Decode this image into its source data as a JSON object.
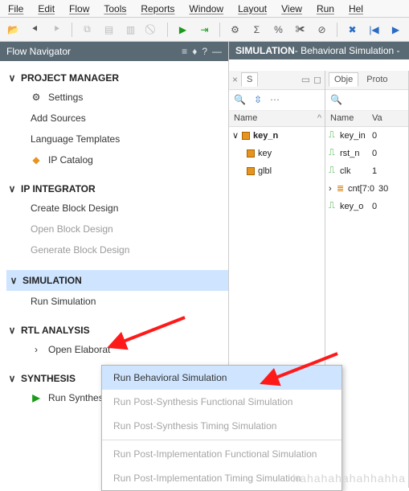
{
  "menu": {
    "items": [
      "File",
      "Edit",
      "Flow",
      "Tools",
      "Reports",
      "Window",
      "Layout",
      "View",
      "Run",
      "Hel"
    ]
  },
  "toolbar": {
    "icons": [
      "folder-open",
      "back",
      "history",
      "copy",
      "paste",
      "cut",
      "undo",
      "play",
      "step",
      "gear",
      "sigma",
      "percent",
      "scissors",
      "no-link",
      "resume",
      "next"
    ]
  },
  "nav": {
    "title": "Flow Navigator",
    "sections": [
      {
        "title": "PROJECT MANAGER",
        "items": [
          {
            "icon": "gear",
            "label": "Settings"
          },
          {
            "icon": "",
            "label": "Add Sources"
          },
          {
            "icon": "",
            "label": "Language Templates"
          },
          {
            "icon": "ip",
            "label": "IP Catalog"
          }
        ]
      },
      {
        "title": "IP INTEGRATOR",
        "items": [
          {
            "icon": "",
            "label": "Create Block Design"
          },
          {
            "icon": "",
            "label": "Open Block Design",
            "dim": true
          },
          {
            "icon": "",
            "label": "Generate Block Design",
            "dim": true
          }
        ]
      },
      {
        "title": "SIMULATION",
        "highlight": true,
        "items": [
          {
            "icon": "",
            "label": "Run Simulation"
          }
        ]
      },
      {
        "title": "RTL ANALYSIS",
        "items": [
          {
            "icon": "chev",
            "label": "Open Elaborat"
          }
        ]
      },
      {
        "title": "SYNTHESIS",
        "items": [
          {
            "icon": "play",
            "label": "Run Synthesis"
          }
        ]
      }
    ]
  },
  "right": {
    "header_bold": "SIMULATION",
    "header_rest": " - Behavioral Simulation -",
    "left_panel": {
      "tabs": [
        "S"
      ],
      "tools": [
        "search",
        "collapse",
        "more"
      ],
      "col": "Name",
      "rows": [
        {
          "lvl": 0,
          "icon": "orange",
          "label": "key_n",
          "exp": "∨"
        },
        {
          "lvl": 1,
          "icon": "orange",
          "label": "key"
        },
        {
          "lvl": 1,
          "icon": "orange",
          "label": "glbl"
        }
      ]
    },
    "right_panel": {
      "tabs": [
        "Obje",
        "Proto"
      ],
      "tools": [
        "search"
      ],
      "cols": [
        "Name",
        "Va"
      ],
      "rows": [
        {
          "icon": "sig",
          "label": "key_in",
          "val": "0"
        },
        {
          "icon": "sig",
          "label": "rst_n",
          "val": "0"
        },
        {
          "icon": "sig",
          "label": "clk",
          "val": "1"
        },
        {
          "icon": "bus",
          "label": "cnt[7:0",
          "val": "30",
          "exp": ">"
        },
        {
          "icon": "sig",
          "label": "key_o",
          "val": "0"
        }
      ]
    }
  },
  "popup": {
    "items": [
      {
        "label": "Run Behavioral Simulation",
        "hover": true
      },
      {
        "label": "Run Post-Synthesis Functional Simulation",
        "dim": true
      },
      {
        "label": "Run Post-Synthesis Timing Simulation",
        "dim": true
      },
      {
        "label": "Run Post-Implementation Functional Simulation",
        "dim": true
      },
      {
        "label": "Run Post-Implementation Timing Simulation",
        "dim": true
      }
    ]
  },
  "watermark": "hahahahahahhahha"
}
